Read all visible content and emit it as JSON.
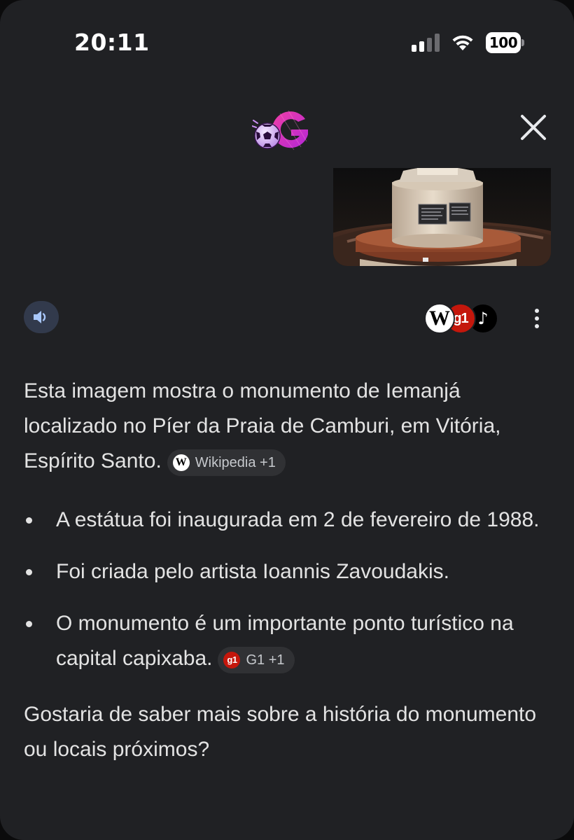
{
  "status_bar": {
    "time": "20:11",
    "battery": "100"
  },
  "header": {
    "logo_letter": "G",
    "close_icon": "close-icon"
  },
  "colors": {
    "background": "#202124",
    "text": "#e3e3e3",
    "chip_bg": "#303134",
    "speaker_bg": "#323a4c",
    "g1_red": "#c4170c",
    "logo_magenta": "#d433c4"
  },
  "toolbar": {
    "speak_icon": "speaker-icon",
    "sources": [
      {
        "label": "W",
        "icon": "wikipedia-icon"
      },
      {
        "label": "g1",
        "icon": "g1-icon"
      },
      {
        "label": "♪",
        "icon": "tiktok-icon"
      }
    ],
    "more_icon": "more-vertical-icon"
  },
  "answer": {
    "intro": "Esta imagem mostra o monumento de Iemanjá localizado no Píer da Praia de Camburi, em Vitória, Espírito Santo.",
    "intro_chip": {
      "icon_label": "W",
      "label": "Wikipedia +1"
    },
    "bullets": [
      {
        "text": "A estátua foi inaugurada em 2 de fevereiro de 1988."
      },
      {
        "text": "Foi criada pelo artista Ioannis Zavoudakis."
      },
      {
        "text": "O monumento é um importante ponto turístico na capital capixaba."
      }
    ],
    "bullet_chip": {
      "icon_label": "g1",
      "label": "G1 +1"
    },
    "followup": "Gostaria de saber mais sobre a história do monumento ou locais próximos?"
  }
}
